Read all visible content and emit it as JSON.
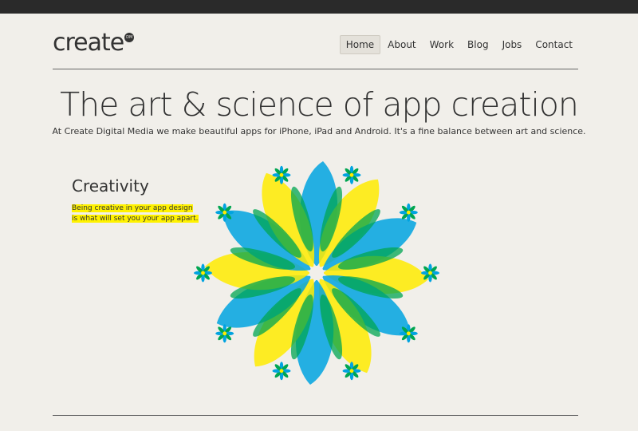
{
  "header": {
    "logo_text": "create",
    "logo_badge": "DM"
  },
  "nav": {
    "items": [
      "Home",
      "About",
      "Work",
      "Blog",
      "Jobs",
      "Contact"
    ],
    "active": "Home"
  },
  "hero": {
    "headline": "The art & science of app creation",
    "intro": "At Create Digital Media we make beautiful apps for iPhone, iPad and Android. It's a fine balance between art and science."
  },
  "feature": {
    "title": "Creativity",
    "description": "Being creative in your app design is what will set you your app apart."
  },
  "colors": {
    "background": "#f1efea",
    "topbar": "#2a2a2a",
    "text": "#333333",
    "highlight": "#fff200",
    "petal_yellow": "#ffeb00",
    "petal_blue": "#00a3e0",
    "petal_green": "#00a651"
  },
  "illustration": {
    "petal_count": 12,
    "small_flower_count": 10
  }
}
